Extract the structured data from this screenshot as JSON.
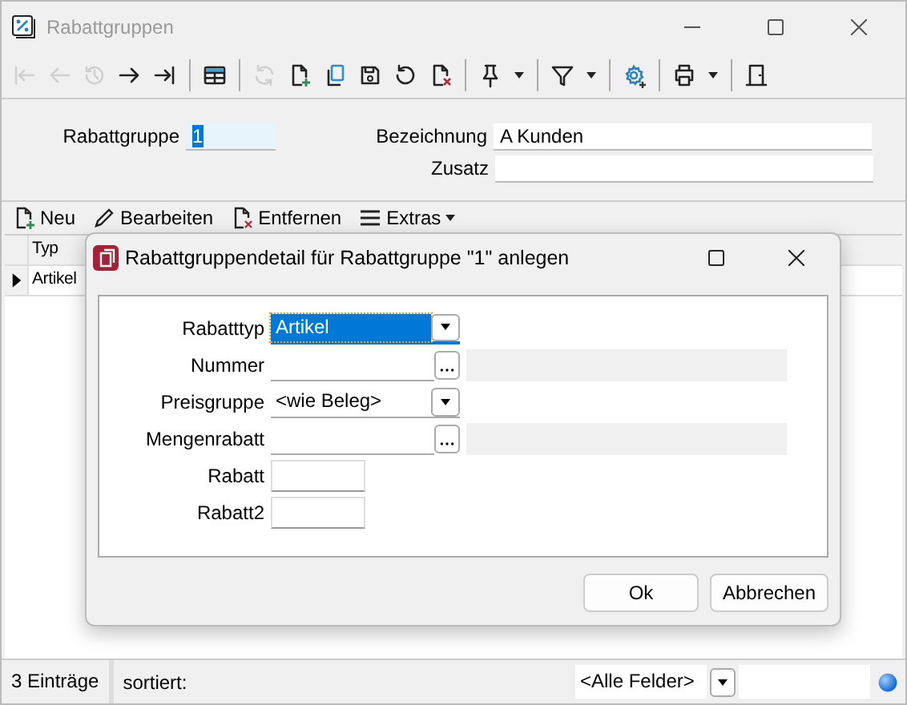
{
  "window": {
    "title": "Rabattgruppen"
  },
  "toolbar": [
    {
      "disabled": true
    },
    {
      "disabled": true
    },
    {
      "disabled": true
    },
    {
      "disabled": false
    },
    {
      "disabled": false
    },
    {
      "disabled": false
    },
    {
      "disabled": true
    },
    {
      "disabled": false
    },
    {
      "disabled": false
    },
    {
      "disabled": false
    },
    {
      "disabled": false
    },
    {
      "disabled": false
    },
    {
      "disabled": false
    },
    {
      "disabled": false
    },
    {
      "disabled": false
    },
    {
      "disabled": false
    },
    {
      "disabled": false
    }
  ],
  "form": {
    "rabattgruppe": {
      "label": "Rabattgruppe",
      "value": "1"
    },
    "bezeichnung": {
      "label": "Bezeichnung",
      "value": "A Kunden"
    },
    "zusatz": {
      "label": "Zusatz"
    }
  },
  "list_toolbar": [
    "Neu",
    "Bearbeiten",
    "Entfernen",
    "Extras"
  ],
  "grid": {
    "columns": [
      "Typ"
    ],
    "rows": [
      {
        "cells": [
          "Artikel"
        ],
        "selected": true
      }
    ]
  },
  "dialog": {
    "title": "Rabattgruppendetail für Rabattgruppe \"1\" anlegen",
    "fields": [
      {
        "label": "Rabatttyp",
        "kind": "combo",
        "value": "Artikel",
        "focused": true
      },
      {
        "label": "Nummer",
        "kind": "lookup",
        "focused": false
      },
      {
        "label": "Preisgruppe",
        "kind": "combo",
        "value": "<wie Beleg>",
        "focused": false
      },
      {
        "label": "Mengenrabatt",
        "kind": "lookup",
        "focused": false
      },
      {
        "label": "Rabatt",
        "kind": "short",
        "focused": false
      },
      {
        "label": "Rabatt2",
        "kind": "short",
        "focused": false
      }
    ],
    "buttons": [
      "Ok",
      "Abbrechen"
    ]
  },
  "status_bar": {
    "count": "3 Einträge",
    "sort": "sortiert:",
    "filter": "<Alle Felder>"
  }
}
